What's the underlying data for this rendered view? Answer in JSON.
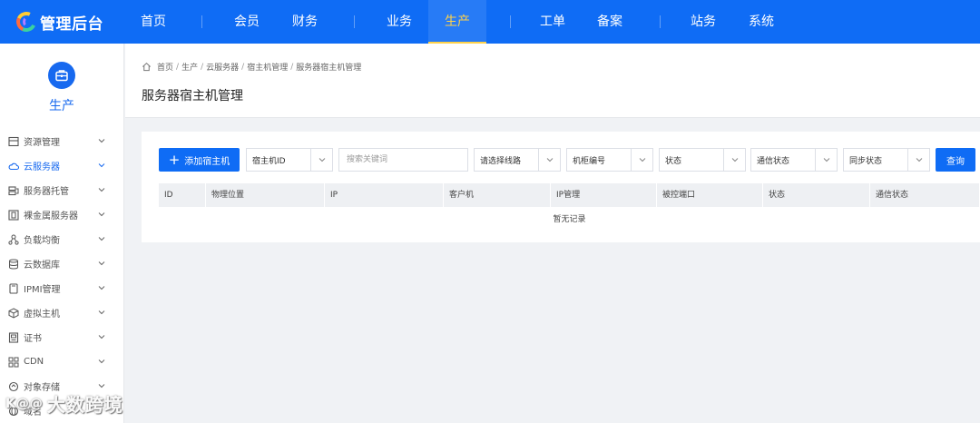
{
  "app": {
    "logo_text": "管理后台"
  },
  "nav": [
    {
      "label": "首页"
    },
    {
      "label": "会员"
    },
    {
      "label": "财务"
    },
    {
      "label": "业务"
    },
    {
      "label": "生产",
      "active": true
    },
    {
      "label": "工单"
    },
    {
      "label": "备案"
    },
    {
      "label": "站务"
    },
    {
      "label": "系统"
    }
  ],
  "sidebar": {
    "title": "生产",
    "items": [
      {
        "label": "资源管理",
        "icon": "server-rack-icon"
      },
      {
        "label": "云服务器",
        "icon": "cloud-icon",
        "active": true
      },
      {
        "label": "服务器托管",
        "icon": "hosting-icon"
      },
      {
        "label": "裸金属服务器",
        "icon": "bare-metal-icon"
      },
      {
        "label": "负载均衡",
        "icon": "load-balancer-icon"
      },
      {
        "label": "云数据库",
        "icon": "database-icon"
      },
      {
        "label": "IPMI管理",
        "icon": "ipmi-icon"
      },
      {
        "label": "虚拟主机",
        "icon": "cube-icon"
      },
      {
        "label": "证书",
        "icon": "certificate-icon"
      },
      {
        "label": "CDN",
        "icon": "cdn-icon"
      },
      {
        "label": "对象存储",
        "icon": "storage-icon"
      },
      {
        "label": "域名",
        "icon": "globe-icon"
      }
    ]
  },
  "breadcrumb": [
    "首页",
    "生产",
    "云服务器",
    "宿主机管理",
    "服务器宿主机管理"
  ],
  "page": {
    "title": "服务器宿主机管理"
  },
  "toolbar": {
    "add_label": "添加宿主机",
    "field_select": "宿主机ID",
    "search_placeholder": "搜索关键词",
    "line_select": "请选择线路",
    "cabinet_select": "机柜编号",
    "status_select": "状态",
    "comm_status_select": "通信状态",
    "sync_status_select": "同步状态",
    "query_label": "查询"
  },
  "table": {
    "columns": [
      "ID",
      "物理位置",
      "IP",
      "客户机",
      "IP管理",
      "被控端口",
      "状态",
      "通信状态"
    ],
    "empty_text": "暂无记录"
  },
  "watermark": {
    "logo": "K@@",
    "text": "大数跨境"
  },
  "colors": {
    "primary": "#0f6cf5",
    "active_nav": "#ffd24a"
  }
}
